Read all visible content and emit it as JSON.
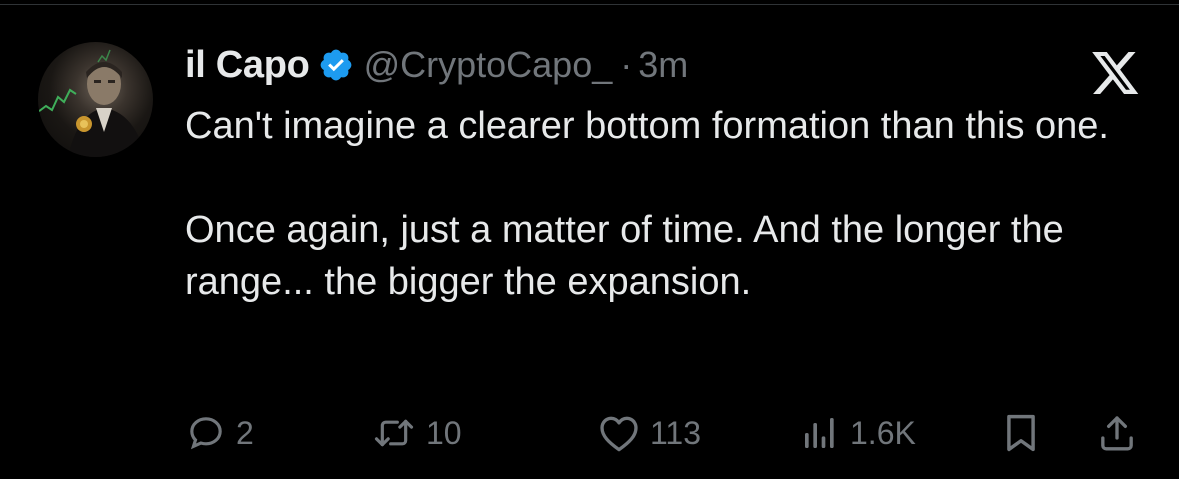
{
  "author": {
    "display_name": "il Capo",
    "handle": "@CryptoCapo_",
    "separator": "·",
    "timestamp": "3m",
    "verified": true,
    "verified_color": "#1d9bf0"
  },
  "tweet": {
    "paragraph_1": "Can't imagine a clearer bottom formation than this one.",
    "paragraph_2": "Once again, just a matter of time. And the longer the range... the bigger the expansion."
  },
  "actions": {
    "reply_count": "2",
    "retweet_count": "10",
    "like_count": "113",
    "views_count": "1.6K"
  },
  "icons": {
    "reply": "reply-bubble-icon",
    "retweet": "retweet-icon",
    "like": "heart-icon",
    "views": "views-bar-chart-icon",
    "bookmark": "bookmark-icon",
    "share": "share-upload-icon",
    "brand": "x-logo-icon",
    "verified": "verified-badge-icon"
  },
  "colors": {
    "background": "#000000",
    "text_primary": "#e7e9ea",
    "text_secondary": "#71767b"
  }
}
